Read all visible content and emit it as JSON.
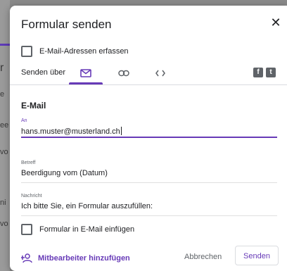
{
  "dialog": {
    "title": "Formular senden",
    "close_icon": "close-icon",
    "collect_emails_label": "E-Mail-Adressen erfassen",
    "send_via_label": "Senden über",
    "tabs": [
      {
        "name": "email",
        "icon": "mail-icon",
        "active": true
      },
      {
        "name": "link",
        "icon": "link-icon",
        "active": false
      },
      {
        "name": "embed",
        "icon": "embed-icon",
        "active": false
      }
    ],
    "social": [
      {
        "name": "facebook",
        "icon": "facebook-icon",
        "glyph": "f"
      },
      {
        "name": "twitter",
        "icon": "twitter-icon",
        "glyph": "t"
      }
    ],
    "accent_color": "#673ab7"
  },
  "email": {
    "section_title": "E-Mail",
    "to_label": "An",
    "to_value": "hans.muster@musterland.ch",
    "subject_label": "Betreff",
    "subject_value": "Beerdigung vom (Datum)",
    "message_label": "Nachricht",
    "message_value": "Ich bitte Sie, ein Formular auszufüllen:",
    "include_form_label": "Formular in E-Mail einfügen"
  },
  "footer": {
    "add_collaborators": "Mitbearbeiter hinzufügen",
    "cancel": "Abbrechen",
    "send": "Senden"
  },
  "background": {
    "fragments": [
      "r",
      "e",
      "ee",
      "vo",
      "ni",
      "vo"
    ]
  }
}
